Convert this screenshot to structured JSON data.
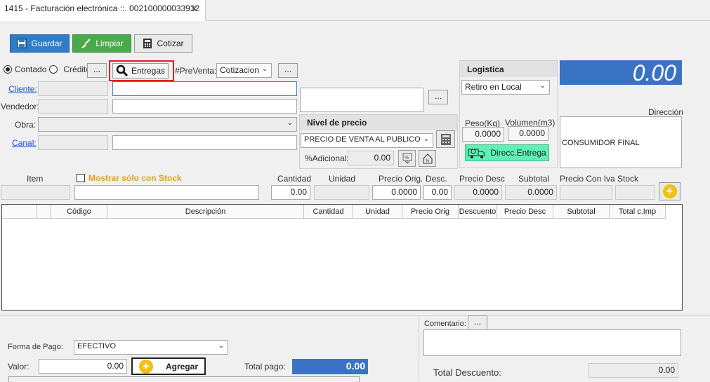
{
  "tab": {
    "title": "1415 - Facturación electrónica ::. 002100000033932",
    "close": "✕"
  },
  "toolbar": {
    "save": "Guardar",
    "clear": "Limpiar",
    "quote": "Cotizar"
  },
  "payment": {
    "contado": "Contado",
    "credito": "Crédito",
    "dots": "...",
    "entregas": "Entregas",
    "preventa_label": "#PreVenta:",
    "preventa_value": "Cotizacion",
    "preventa_dots": "..."
  },
  "customer": {
    "cliente_label": "Cliente:",
    "vendedor_label": "Vendedor:",
    "obra_label": "Obra:",
    "canal_label": "Canal:",
    "extra_dots": "...",
    "direccion_label": "Dirección",
    "direccion_value": "CONSUMIDOR FINAL"
  },
  "pricing": {
    "title": "Nivel de precio",
    "level": "PRECIO DE VENTA AL PUBLICO",
    "adicional_label": "%Adicional:",
    "adicional_value": "0.00"
  },
  "logistics": {
    "title": "Logistica",
    "mode": "Retiro en Local",
    "peso_label": "Peso(Kg)",
    "peso_value": "0.0000",
    "volumen_label": "Volumen(m3)",
    "volumen_value": "0.0000",
    "entrega_button": "Direcc.Entrega"
  },
  "total_display": "0.00",
  "item_entry": {
    "item_label": "Item",
    "stock_only": "Mostrar sólo con Stock",
    "cantidad_label": "Cantidad",
    "cantidad_value": "0.00",
    "unidad_label": "Unidad",
    "precio_orig_label": "Precio Orig.",
    "precio_orig_value": "0.0000",
    "desc_label": "Desc.",
    "desc_value": "0.00",
    "precio_desc_label": "Precio Desc",
    "precio_desc_value": "0.0000",
    "subtotal_label": "Subtotal",
    "subtotal_value": "0.0000",
    "precio_iva_label": "Precio Con Iva",
    "stock_label": "Stock"
  },
  "grid": {
    "columns": [
      "",
      "",
      "Código",
      "Descripción",
      "Cantidad",
      "Unidad",
      "Precio Orig",
      "Descuento",
      "Precio Desc",
      "Subtotal",
      "Total c.Imp"
    ]
  },
  "footer": {
    "forma_pago_label": "Forma de Pago:",
    "forma_pago_value": "EFECTIVO",
    "valor_label": "Valor:",
    "valor_value": "0.00",
    "agregar": "Agregar",
    "total_pago_label": "Total pago:",
    "total_pago_value": "0.00",
    "comentario_label": "Comentario:",
    "comentario_dots": "...",
    "total_descuento_label": "Total Descuento:",
    "total_descuento_value": "0.00"
  },
  "colors": {
    "accent_blue": "#2f7dc7",
    "total_bg": "#3a73c4",
    "highlight_red": "#e02020",
    "entrega_green": "#5ef0b4"
  }
}
